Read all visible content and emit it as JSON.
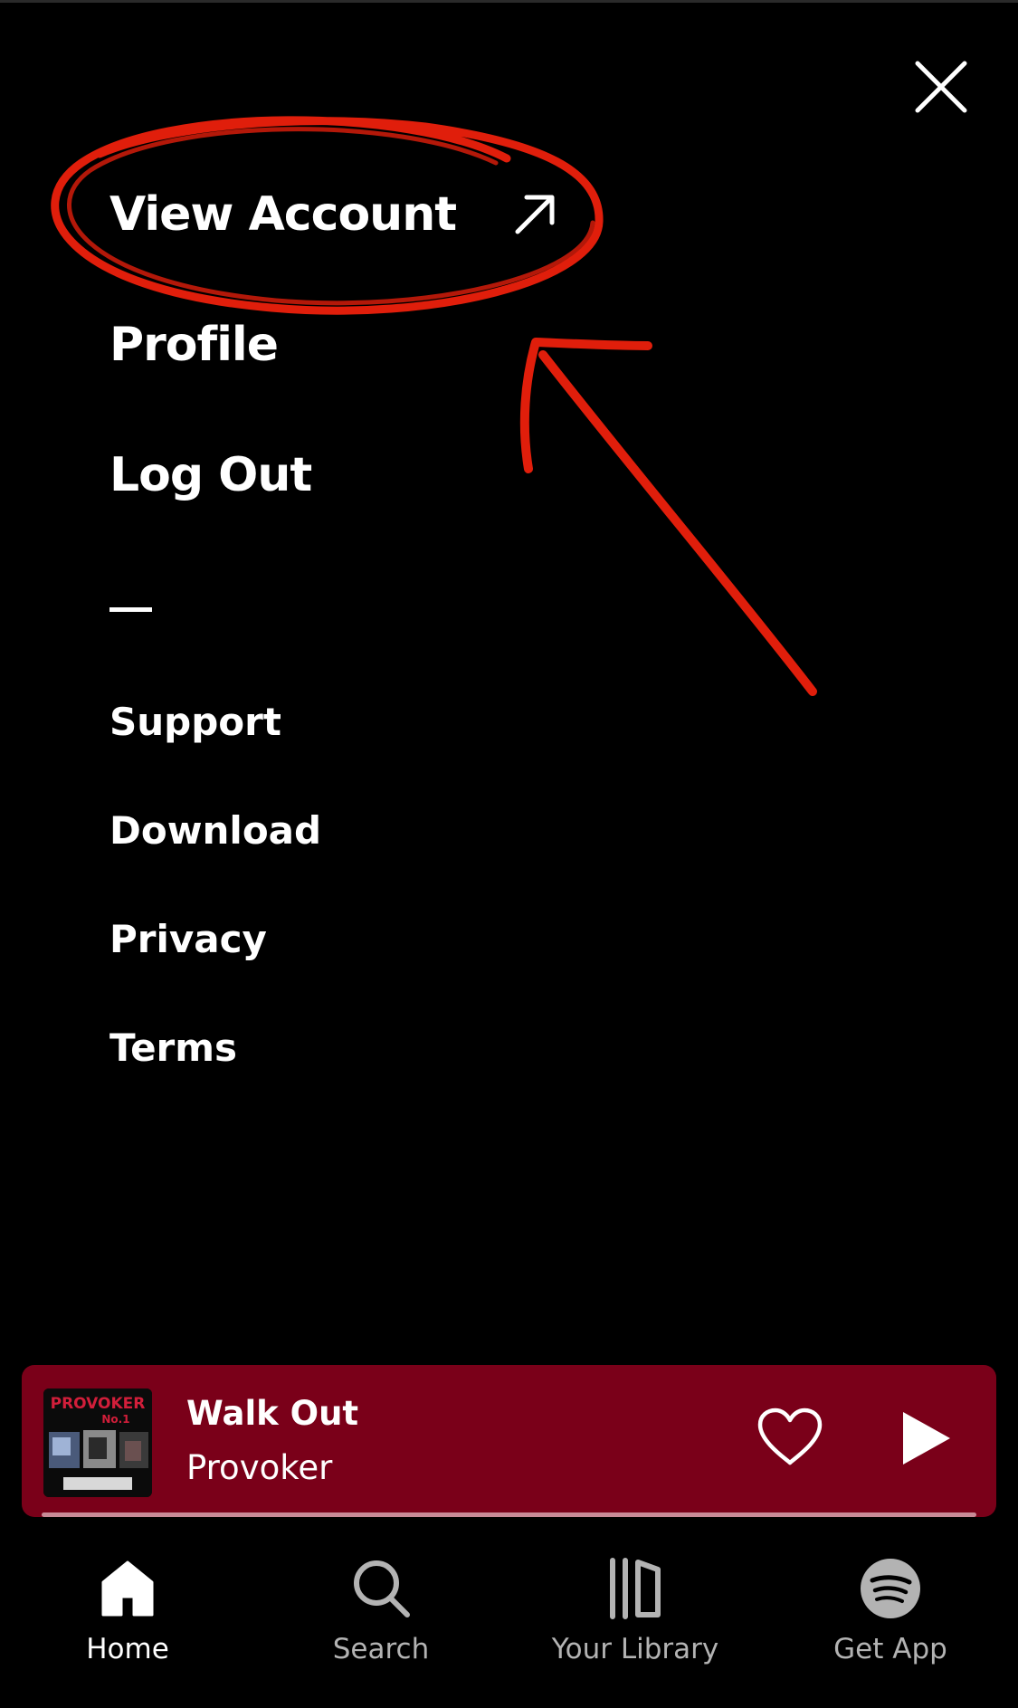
{
  "menu": {
    "primary": [
      {
        "label": "View Account",
        "icon": "external-link-icon"
      },
      {
        "label": "Profile"
      },
      {
        "label": "Log Out"
      }
    ],
    "secondary": [
      {
        "label": "Support"
      },
      {
        "label": "Download"
      },
      {
        "label": "Privacy"
      },
      {
        "label": "Terms"
      }
    ]
  },
  "close_icon": "close-icon",
  "now_playing": {
    "title": "Walk Out",
    "artist": "Provoker",
    "album_art_text": "PROVOKER No.1",
    "background_color": "#7a0019",
    "progress": 0.0
  },
  "bottom_nav": {
    "items": [
      {
        "label": "Home",
        "icon": "home-icon",
        "active": true
      },
      {
        "label": "Search",
        "icon": "search-icon",
        "active": false
      },
      {
        "label": "Your Library",
        "icon": "library-icon",
        "active": false
      },
      {
        "label": "Get App",
        "icon": "spotify-logo-icon",
        "active": false
      }
    ]
  },
  "annotation": {
    "color": "#e01e0b",
    "shapes": [
      "circle",
      "arrow"
    ]
  }
}
